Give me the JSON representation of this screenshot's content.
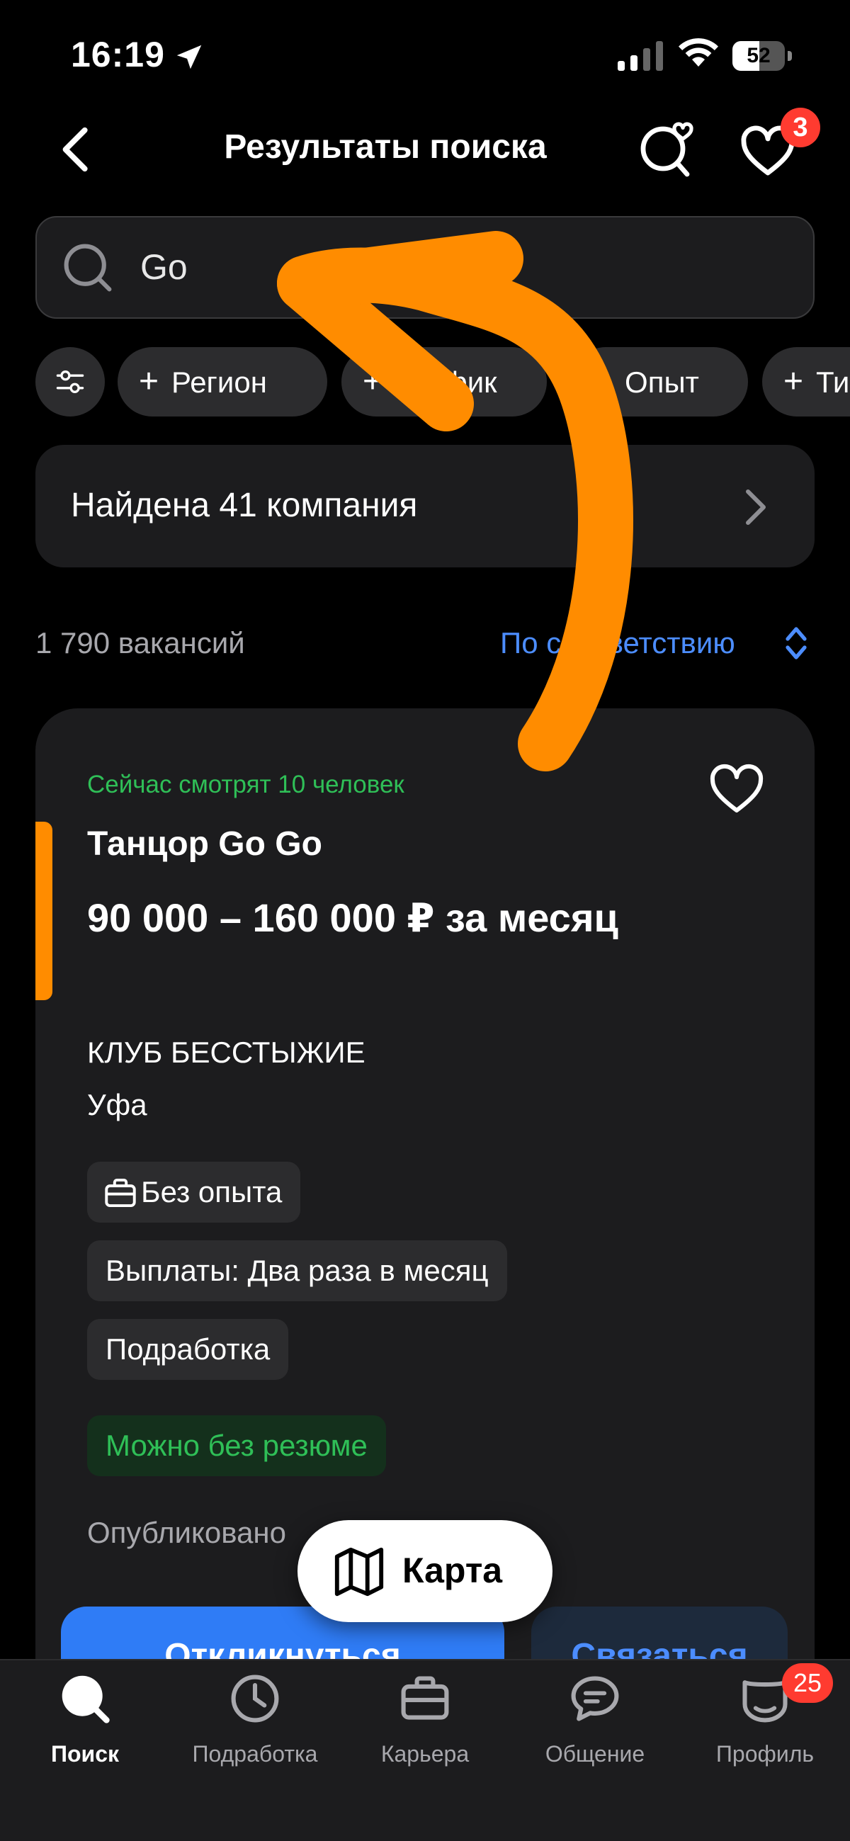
{
  "status_bar": {
    "time": "16:19",
    "battery": "52",
    "battery_level": 0.52
  },
  "header": {
    "title": "Результаты поиска",
    "favorites_badge": "3"
  },
  "search": {
    "value": "Go"
  },
  "filters": {
    "chips": [
      {
        "label": "Регион"
      },
      {
        "label": "График"
      },
      {
        "label": "Опыт"
      },
      {
        "label": "Тип"
      }
    ]
  },
  "companies": {
    "label": "Найдена 41 компания"
  },
  "results": {
    "count": "1 790 вакансий",
    "sort": "По соответствию"
  },
  "vacancy": {
    "viewers": "Сейчас смотрят 10 человек",
    "title": "Танцор Go Go",
    "salary": "90 000 – 160 000 ₽ за месяц",
    "company": "КЛУБ БЕССТЫЖИЕ",
    "city": "Уфа",
    "tags": [
      "Без опыта",
      "Выплаты: Два раза в месяц",
      "Подработка"
    ],
    "resume_tag": "Можно без резюме",
    "published": "Опубликовано",
    "apply_label": "Откликнуться",
    "contact_label": "Связаться"
  },
  "map_button": {
    "label": "Карта"
  },
  "tabbar": {
    "items": [
      {
        "label": "Поиск",
        "icon": "search-icon"
      },
      {
        "label": "Подработка",
        "icon": "clock-icon"
      },
      {
        "label": "Карьера",
        "icon": "briefcase-icon"
      },
      {
        "label": "Общение",
        "icon": "chat-icon"
      },
      {
        "label": "Профиль",
        "icon": "profile-icon"
      }
    ],
    "profile_badge": "25"
  },
  "colors": {
    "accent": "#2f7cf6",
    "link": "#4c8dff",
    "success": "#2fbf57",
    "badge": "#ff3b30",
    "annotation": "#ff8c00",
    "vacancy_accent": "#ff8c00"
  }
}
